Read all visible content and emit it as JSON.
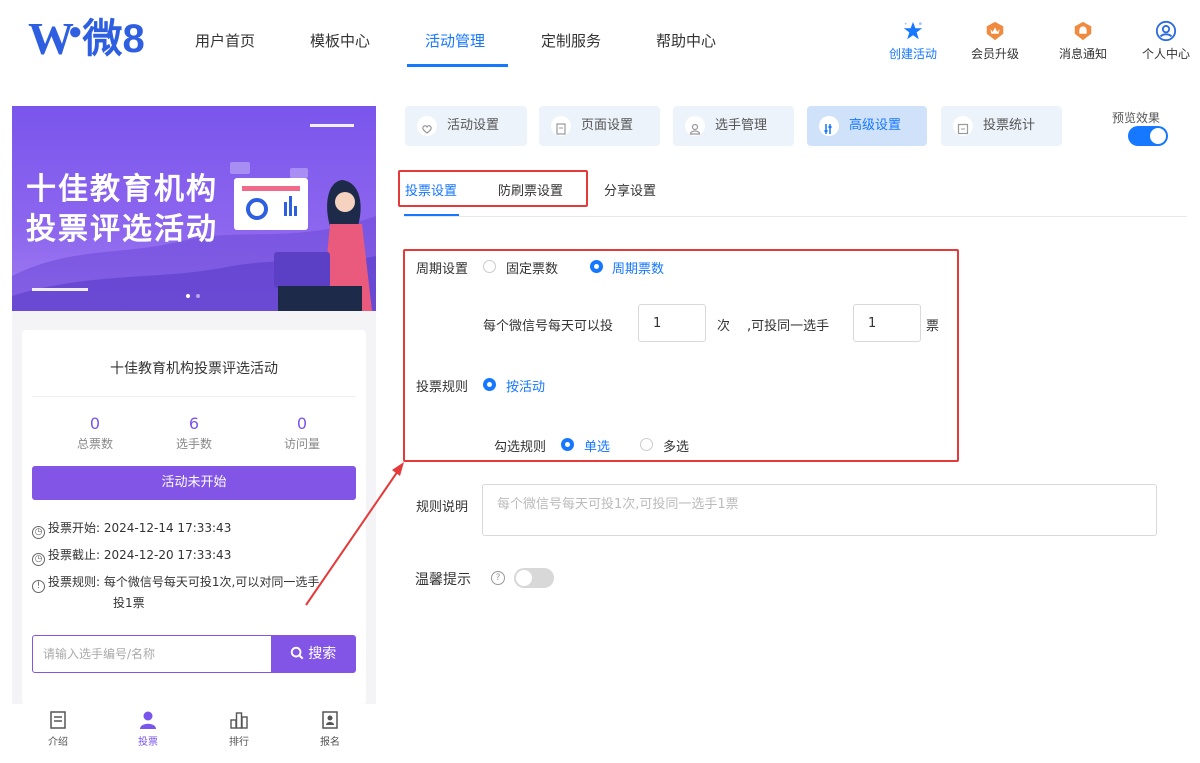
{
  "header": {
    "logo_mark": "W",
    "logo_text": "微8",
    "nav": [
      "用户首页",
      "模板中心",
      "活动管理",
      "定制服务",
      "帮助中心"
    ],
    "active_nav": "活动管理",
    "actions": [
      "创建活动",
      "会员升级",
      "消息通知",
      "个人中心"
    ],
    "accent_color": "#1677ff"
  },
  "preview": {
    "banner_line1": "十佳教育机构",
    "banner_line2": "投票评选活动",
    "title": "十佳教育机构投票评选活动",
    "stats": [
      {
        "value": "0",
        "label": "总票数"
      },
      {
        "value": "6",
        "label": "选手数"
      },
      {
        "value": "0",
        "label": "访问量"
      }
    ],
    "status_button": "活动未开始",
    "vote_start_label": "投票开始:",
    "vote_start": "2024-12-14 17:33:43",
    "vote_end_label": "投票截止:",
    "vote_end": "2024-12-20 17:33:43",
    "rules_label": "投票规则:",
    "rules_line1": "每个微信号每天可投1次,可以对同一选手",
    "rules_line2": "投1票",
    "search_placeholder": "请输入选手编号/名称",
    "search_button": "搜索",
    "tabs": [
      "介绍",
      "投票",
      "排行",
      "报名"
    ],
    "active_tab": "投票",
    "theme_color": "#8255e6"
  },
  "settings": {
    "tabs": [
      "活动设置",
      "页面设置",
      "选手管理",
      "高级设置",
      "投票统计"
    ],
    "active_tab": "高级设置",
    "preview_label": "预览效果",
    "preview_enabled": true,
    "subtabs": [
      "投票设置",
      "防刷票设置",
      "分享设置"
    ],
    "active_subtab": "投票设置",
    "period_label": "周期设置",
    "period_options": [
      "固定票数",
      "周期票数"
    ],
    "period_selected": "周期票数",
    "daily_text": "每个微信号每天可以投",
    "daily_value": "1",
    "times_unit": "次",
    "same_player_text": ",可投同一选手",
    "same_player_value": "1",
    "votes_unit": "票",
    "rule_label": "投票规则",
    "rule_option": "按活动",
    "check_rule_label": "勾选规则",
    "check_options": [
      "单选",
      "多选"
    ],
    "check_selected": "单选",
    "desc_label": "规则说明",
    "desc_placeholder": "每个微信号每天可投1次,可投同一选手1票",
    "tip_label": "温馨提示",
    "tip_enabled": false,
    "highlight_color": "#e43a3a"
  }
}
